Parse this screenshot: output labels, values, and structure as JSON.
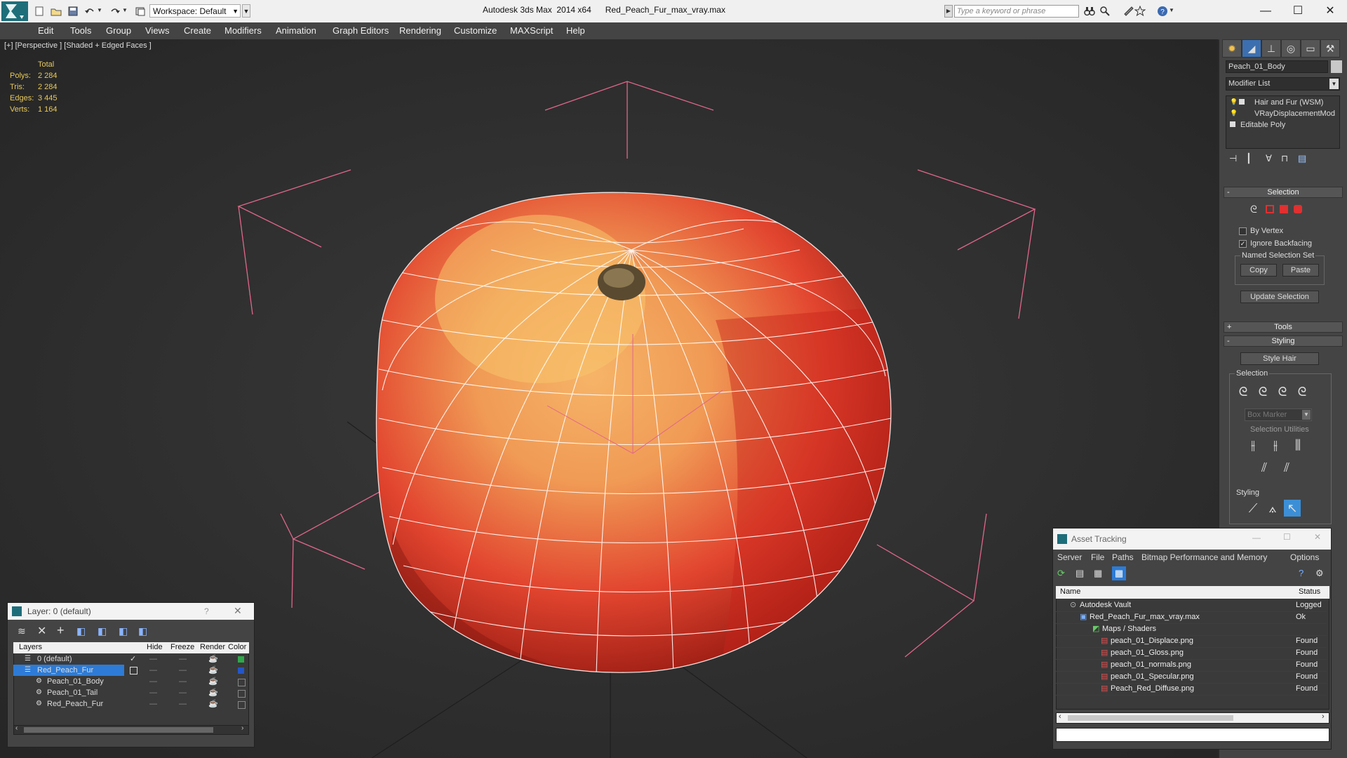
{
  "titlebar": {
    "workspace": "Workspace: Default",
    "app_title": "Autodesk 3ds Max  2014 x64      Red_Peach_Fur_max_vray.max",
    "search_placeholder": "Type a keyword or phrase",
    "minimize": "—",
    "maximize": "☐",
    "close": "✕"
  },
  "menu": [
    "Edit",
    "Tools",
    "Group",
    "Views",
    "Create",
    "Modifiers",
    "Animation",
    "Graph Editors",
    "Rendering",
    "Customize",
    "MAXScript",
    "Help"
  ],
  "viewport": {
    "label": "[+] [Perspective ] [Shaded + Edged Faces ]",
    "stats": {
      "header": "Total",
      "rows": [
        {
          "k": "Polys:",
          "v": "2 284"
        },
        {
          "k": "Tris:",
          "v": "2 284"
        },
        {
          "k": "Edges:",
          "v": "3 445"
        },
        {
          "k": "Verts:",
          "v": "1 164"
        }
      ]
    }
  },
  "command_panel": {
    "object_name": "Peach_01_Body",
    "modifier_list": "Modifier List",
    "stack": [
      "Hair and Fur (WSM)",
      "VRayDisplacementMod",
      "Editable Poly"
    ],
    "selection_rollout": "Selection",
    "by_vertex": "By Vertex",
    "ignore_backfacing": "Ignore Backfacing",
    "named_selection_set": "Named Selection Set",
    "copy": "Copy",
    "paste": "Paste",
    "update_selection": "Update Selection",
    "tools_rollout": "Tools",
    "styling_rollout": "Styling",
    "style_hair": "Style Hair",
    "selection_group": "Selection",
    "box_marker": "Box Marker",
    "selection_utilities": "Selection Utilities",
    "styling_group": "Styling"
  },
  "layer_dialog": {
    "title": "Layer: 0 (default)",
    "help": "?",
    "columns": [
      "Layers",
      "Hide",
      "Freeze",
      "Render",
      "Color"
    ],
    "rows": [
      {
        "name": "0 (default)",
        "color": "#2fa84a"
      },
      {
        "name": "Red_Peach_Fur",
        "color": "#2456c8"
      },
      {
        "name": "Peach_01_Body",
        "color": "#2a2a2a"
      },
      {
        "name": "Peach_01_Tail",
        "color": "#2a2a2a"
      },
      {
        "name": "Red_Peach_Fur",
        "color": "#2a2a2a"
      }
    ]
  },
  "asset_dialog": {
    "title": "Asset Tracking",
    "menu": [
      "Server",
      "File",
      "Paths",
      "Bitmap Performance and Memory",
      "Options"
    ],
    "columns": [
      "Name",
      "Status"
    ],
    "rows": [
      {
        "name": "Autodesk Vault",
        "status": "Logged"
      },
      {
        "name": "Red_Peach_Fur_max_vray.max",
        "status": "Ok"
      },
      {
        "name": "Maps / Shaders",
        "status": ""
      },
      {
        "name": "peach_01_Displace.png",
        "status": "Found"
      },
      {
        "name": "peach_01_Gloss.png",
        "status": "Found"
      },
      {
        "name": "peach_01_normals.png",
        "status": "Found"
      },
      {
        "name": "peach_01_Specular.png",
        "status": "Found"
      },
      {
        "name": "Peach_Red_Diffuse.png",
        "status": "Found"
      }
    ]
  }
}
